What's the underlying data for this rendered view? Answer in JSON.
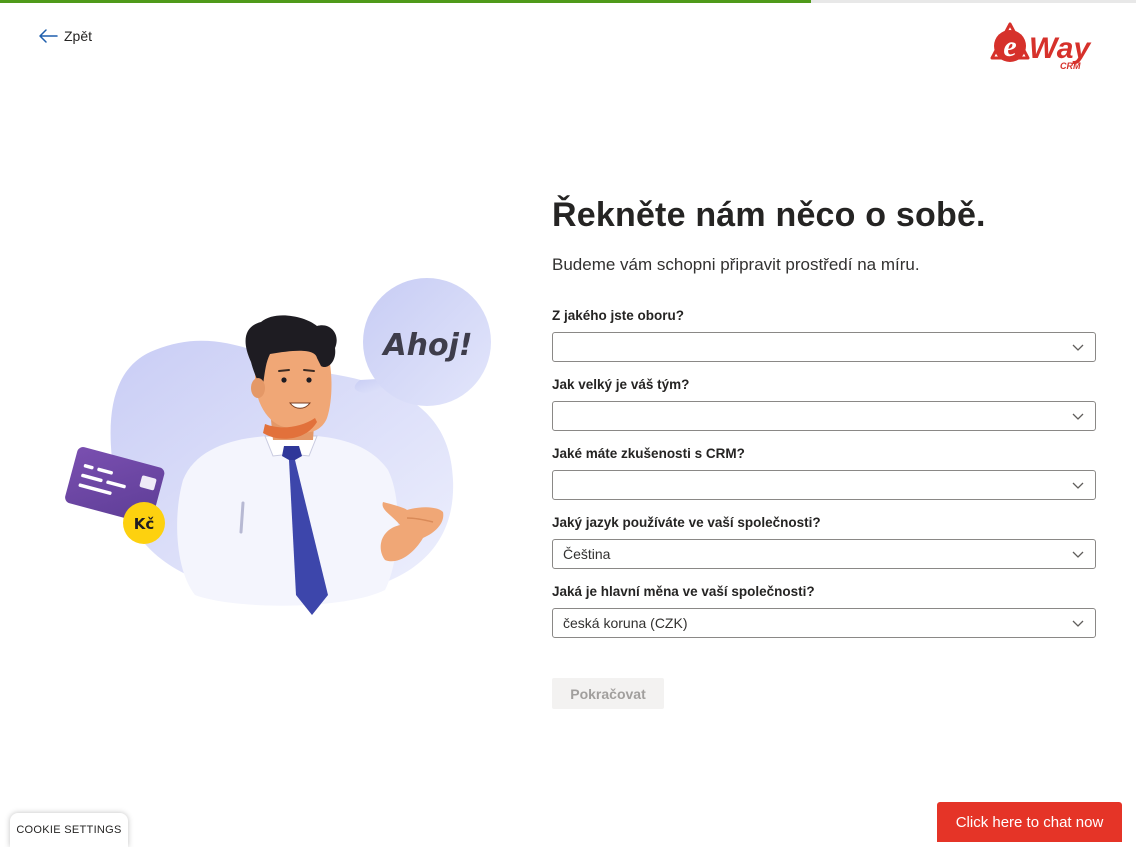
{
  "progress": {
    "fraction": 0.714,
    "fill_color": "#4f9a1a"
  },
  "nav": {
    "back_label": "Zpět",
    "back_icon": "arrow-left-icon"
  },
  "brand": {
    "logo_text": "e",
    "logo_word": "Way",
    "logo_sub": "CRM",
    "color": "#d6312b"
  },
  "illustration": {
    "speech_text": "Ahoj!",
    "currency_badge": "Kč"
  },
  "form": {
    "title": "Řekněte nám něco o sobě.",
    "subtitle": "Budeme vám schopni připravit prostředí na míru.",
    "fields": [
      {
        "label": "Z jakého jste oboru?",
        "value": ""
      },
      {
        "label": "Jak velký je váš tým?",
        "value": ""
      },
      {
        "label": "Jaké máte zkušenosti s CRM?",
        "value": ""
      },
      {
        "label": "Jaký jazyk používáte ve vaší společnosti?",
        "value": "Čeština"
      },
      {
        "label": "Jaká je hlavní měna ve vaší společnosti?",
        "value": "česká koruna (CZK)"
      }
    ],
    "continue_label": "Pokračovat"
  },
  "footer": {
    "cookie_label": "COOKIE SETTINGS",
    "chat_label": "Click here to chat now",
    "chat_color": "#e53427"
  }
}
